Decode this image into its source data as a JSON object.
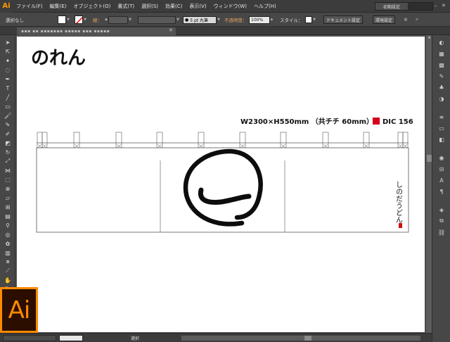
{
  "app": {
    "logo_text": "Ai",
    "big_logo_text": "Ai"
  },
  "menu": {
    "items": [
      "ファイル(F)",
      "編集(E)",
      "オブジェクト(O)",
      "書式(T)",
      "選択(S)",
      "効果(C)",
      "表示(V)",
      "ウィンドウ(W)",
      "ヘルプ(H)"
    ],
    "workspace_label": "初期設定"
  },
  "control": {
    "selection_label": "選択なし",
    "stroke_label": "線：",
    "brush_label": "5 pt 丸筆",
    "opacity_label": "不透明度：",
    "opacity_value": "100%",
    "style_label": "スタイル：",
    "doc_setup_btn": "ドキュメント設定",
    "prefs_btn": "環境設定"
  },
  "artwork": {
    "title": "のれん",
    "dims_text": "W2300×H550mm （共チチ 60mm）",
    "dic_text": "DIC 156",
    "brand_text": "しのだうどん",
    "colors": {
      "dic": "#d6001c",
      "stamp": "#cc1111"
    }
  },
  "status": {
    "label": "選択"
  }
}
